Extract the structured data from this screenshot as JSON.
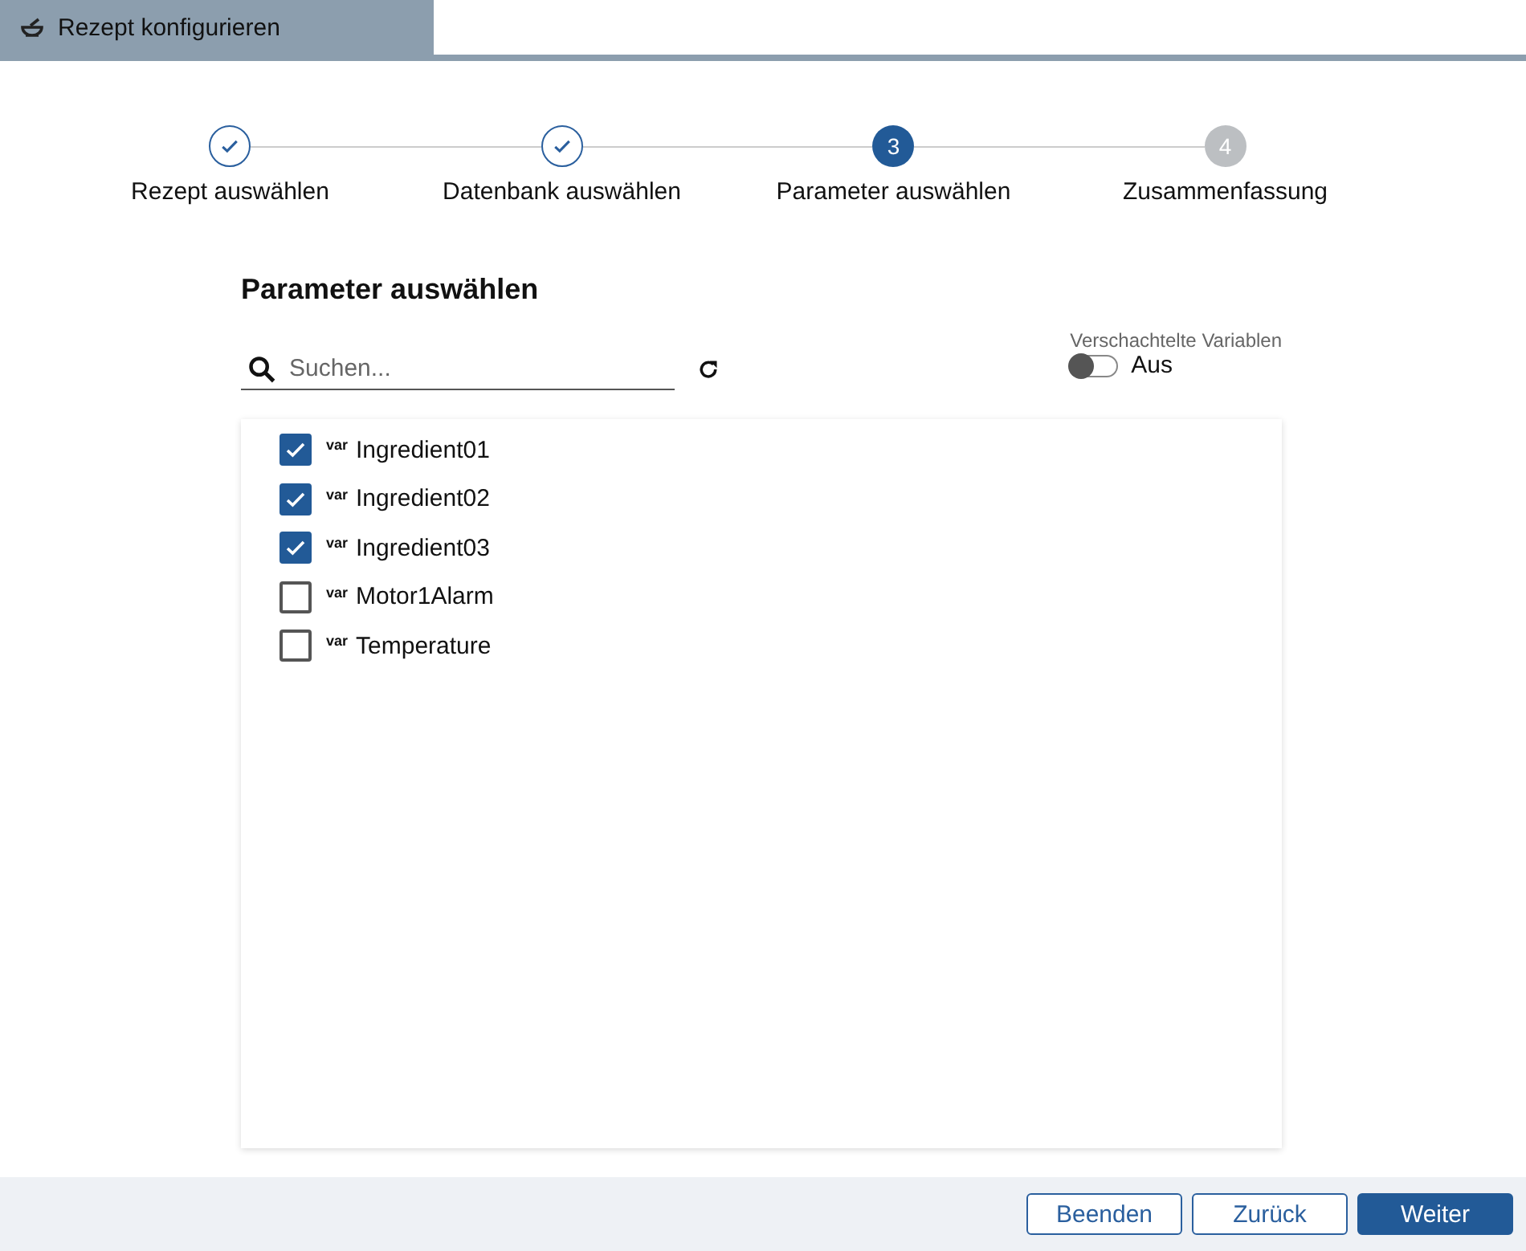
{
  "window": {
    "title": "Rezept konfigurieren"
  },
  "steps": [
    {
      "label": "Rezept auswählen",
      "kind": "done"
    },
    {
      "label": "Datenbank auswählen",
      "kind": "done"
    },
    {
      "label": "Parameter auswählen",
      "kind": "active",
      "number": "3"
    },
    {
      "label": "Zusammenfassung",
      "kind": "pending",
      "number": "4"
    }
  ],
  "heading": "Parameter auswählen",
  "search": {
    "placeholder": "Suchen..."
  },
  "nested_toggle": {
    "label": "Verschachtelte Variablen",
    "on": false,
    "state_text": "Aus"
  },
  "variables": [
    {
      "tag": "var",
      "name": "Ingredient01",
      "checked": true
    },
    {
      "tag": "var",
      "name": "Ingredient02",
      "checked": true
    },
    {
      "tag": "var",
      "name": "Ingredient03",
      "checked": true
    },
    {
      "tag": "var",
      "name": "Motor1Alarm",
      "checked": false
    },
    {
      "tag": "var",
      "name": "Temperature",
      "checked": false
    }
  ],
  "buttons": [
    {
      "label": "Beenden",
      "kind": "secondary"
    },
    {
      "label": "Zurück",
      "kind": "secondary"
    },
    {
      "label": "Weiter",
      "kind": "primary"
    }
  ]
}
